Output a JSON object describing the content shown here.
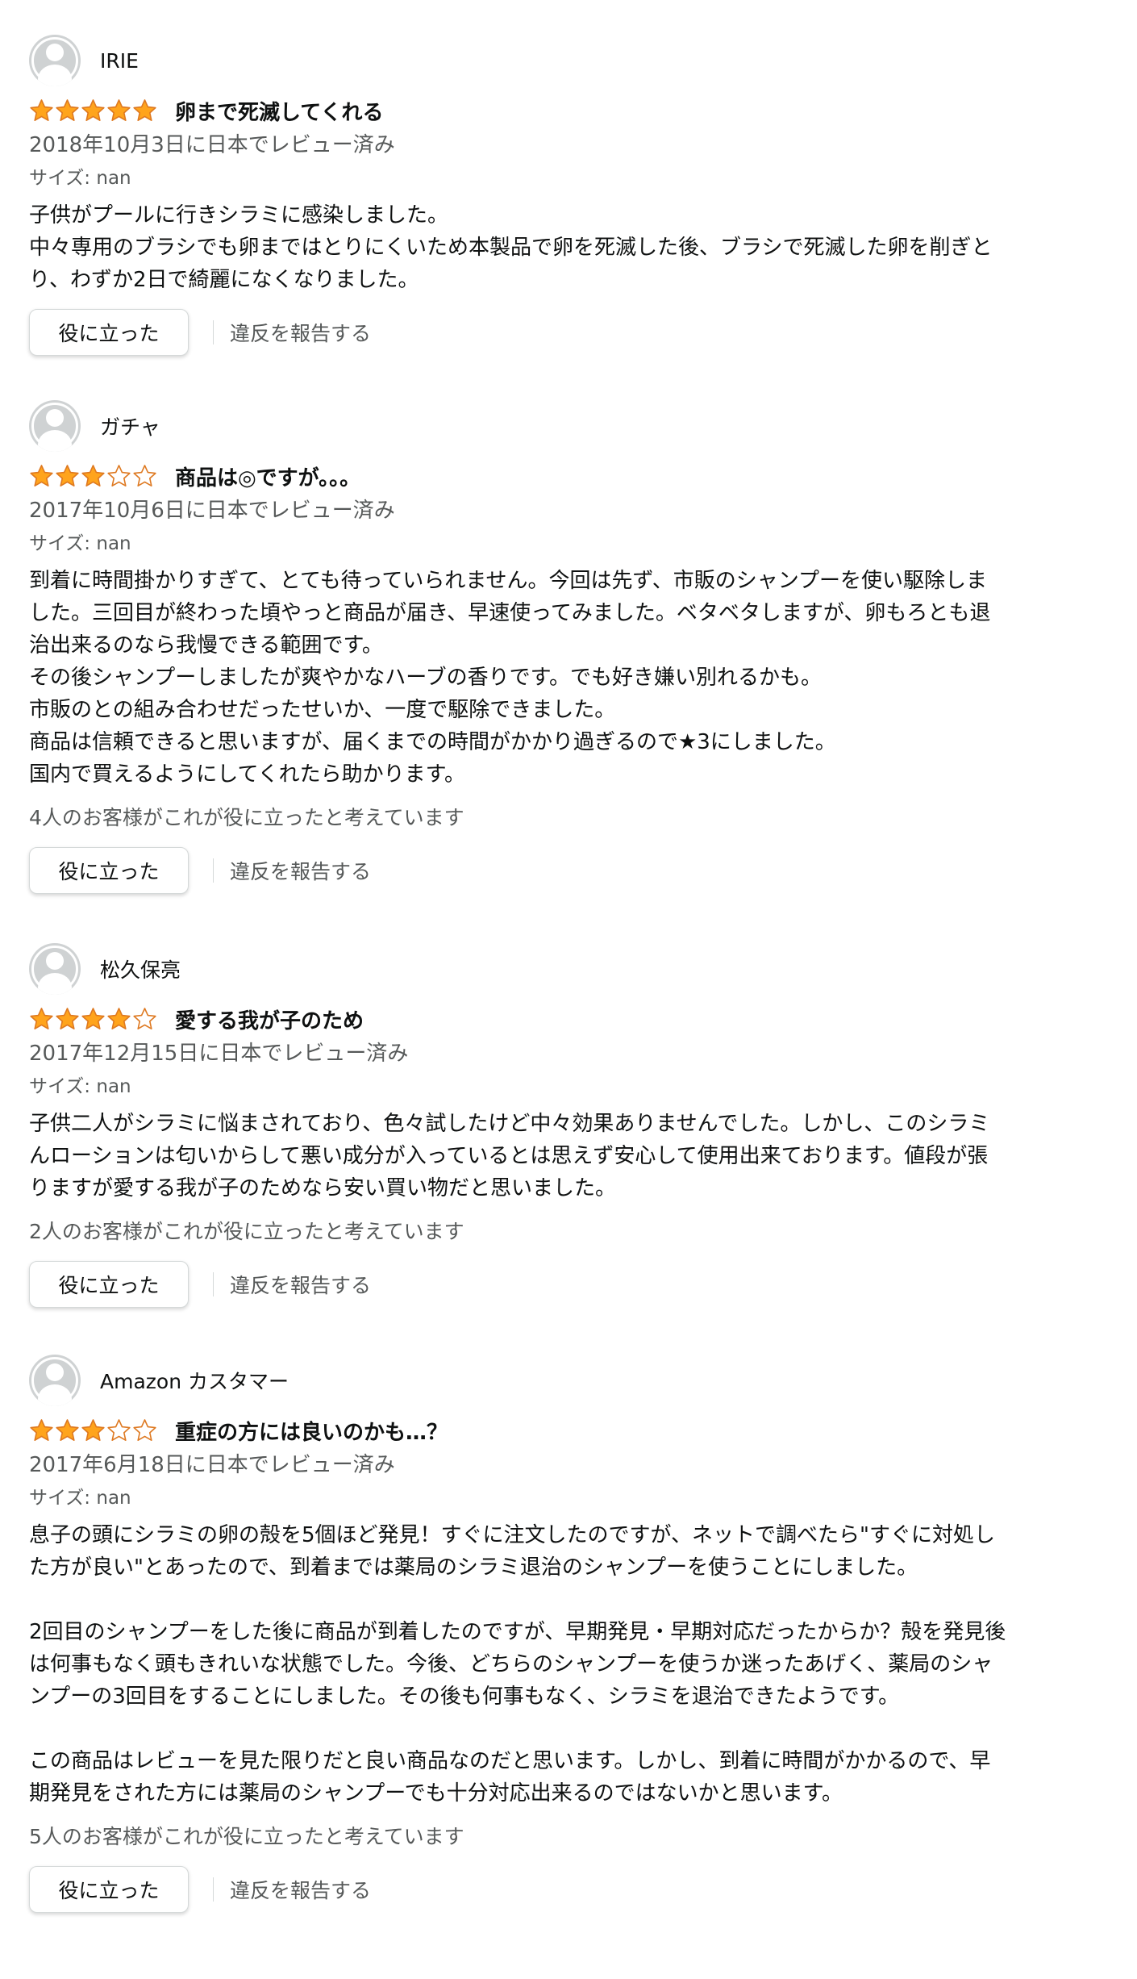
{
  "colors": {
    "star_filled": "#ffa41c",
    "star_border": "#de7921",
    "text_primary": "#0f1111",
    "text_secondary": "#565959"
  },
  "reviews": [
    {
      "reviewer": "IRIE",
      "rating": 5,
      "title": "卵まで死滅してくれる",
      "date": "2018年10月3日に日本でレビュー済み",
      "size": "サイズ: nan",
      "body": "子供がプールに行きシラミに感染しました。\n中々専用のブラシでも卵まではとりにくいため本製品で卵を死滅した後、ブラシで死滅した卵を削ぎと\nり、わずか2日で綺麗になくなりました。",
      "helpful_count": "",
      "helpful_button": "役に立った",
      "report_link": "違反を報告する"
    },
    {
      "reviewer": "ガチャ",
      "rating": 3,
      "title": "商品は◎ですが。。。",
      "date": "2017年10月6日に日本でレビュー済み",
      "size": "サイズ: nan",
      "body": "到着に時間掛かりすぎて、とても待っていられません。今回は先ず、市販のシャンプーを使い駆除しま\nした。三回目が終わった頃やっと商品が届き、早速使ってみました。ベタベタしますが、卵もろとも退\n治出来るのなら我慢できる範囲です。\nその後シャンプーしましたが爽やかなハーブの香りです。でも好き嫌い別れるかも。\n市販のとの組み合わせだったせいか、一度で駆除できました。\n商品は信頼できると思いますが、届くまでの時間がかかり過ぎるので★3にしました。\n国内で買えるようにしてくれたら助かります。",
      "helpful_count": "4人のお客様がこれが役に立ったと考えています",
      "helpful_button": "役に立った",
      "report_link": "違反を報告する"
    },
    {
      "reviewer": "松久保亮",
      "rating": 4,
      "title": "愛する我が子のため",
      "date": "2017年12月15日に日本でレビュー済み",
      "size": "サイズ: nan",
      "body": "子供二人がシラミに悩まされており、色々試したけど中々効果ありませんでした。しかし、このシラミ\nんローションは匂いからして悪い成分が入っているとは思えず安心して使用出来ております。値段が張\nりますが愛する我が子のためなら安い買い物だと思いました。",
      "helpful_count": "2人のお客様がこれが役に立ったと考えています",
      "helpful_button": "役に立った",
      "report_link": "違反を報告する"
    },
    {
      "reviewer": "Amazon カスタマー",
      "rating": 3,
      "title": "重症の方には良いのかも…？",
      "date": "2017年6月18日に日本でレビュー済み",
      "size": "サイズ: nan",
      "body": "息子の頭にシラミの卵の殻を5個ほど発見！すぐに注文したのですが、ネットで調べたら\"すぐに対処し\nた方が良い\"とあったので、到着までは薬局のシラミ退治のシャンプーを使うことにしました。\n\n2回目のシャンプーをした後に商品が到着したのですが、早期発見・早期対応だったからか？殻を発見後\nは何事もなく頭もきれいな状態でした。今後、どちらのシャンプーを使うか迷ったあげく、薬局のシャ\nンプーの3回目をすることにしました。その後も何事もなく、シラミを退治できたようです。\n\nこの商品はレビューを見た限りだと良い商品なのだと思います。しかし、到着に時間がかかるので、早\n期発見をされた方には薬局のシャンプーでも十分対応出来るのではないかと思います。",
      "helpful_count": "5人のお客様がこれが役に立ったと考えています",
      "helpful_button": "役に立った",
      "report_link": "違反を報告する"
    }
  ]
}
